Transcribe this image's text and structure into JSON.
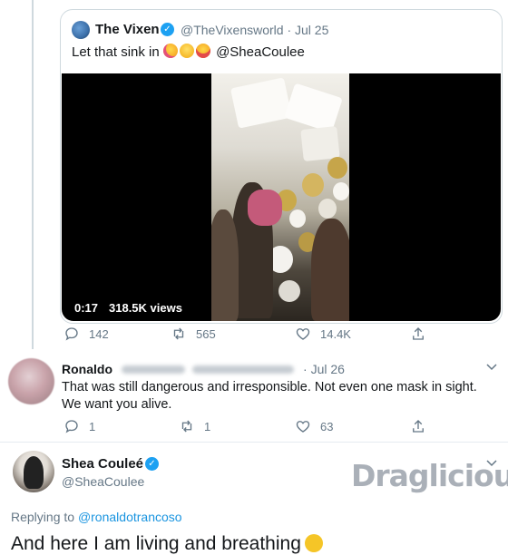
{
  "quoted_tweet": {
    "author_name": "The Vixen",
    "verified_symbol": "✓",
    "author_handle": "@TheVixensworld",
    "separator": "·",
    "date": "Jul 25",
    "text_prefix": "Let that sink in",
    "emoji_names": [
      "party-face-emoji",
      "sunglasses-face-emoji",
      "heart-eyes-emoji"
    ],
    "mention": "@SheaCoulee",
    "video": {
      "duration": "0:17",
      "views": "318.5K views"
    }
  },
  "quoted_actions": {
    "replies": "142",
    "retweets": "565",
    "likes": "14.4K"
  },
  "reply_tweet": {
    "author_name": "Ronaldo",
    "separator": "·",
    "date": "Jul 26",
    "text": "That was still dangerous and irresponsible. Not even one mask in sight. We want you alive.",
    "replies": "1",
    "retweets": "1",
    "likes": "63"
  },
  "main_tweet": {
    "author_name": "Shea Couleé",
    "verified_symbol": "✓",
    "author_handle": "@SheaCoulee",
    "replying_prefix": "Replying to",
    "replying_to": "@ronaldotrancoso",
    "text": "And here I am living and breathing"
  },
  "watermark": "Draglicious",
  "colors": {
    "accent": "#1da1f2",
    "link": "#1b95e0",
    "muted": "#657786",
    "text": "#14171a",
    "border": "#cfd9de"
  }
}
